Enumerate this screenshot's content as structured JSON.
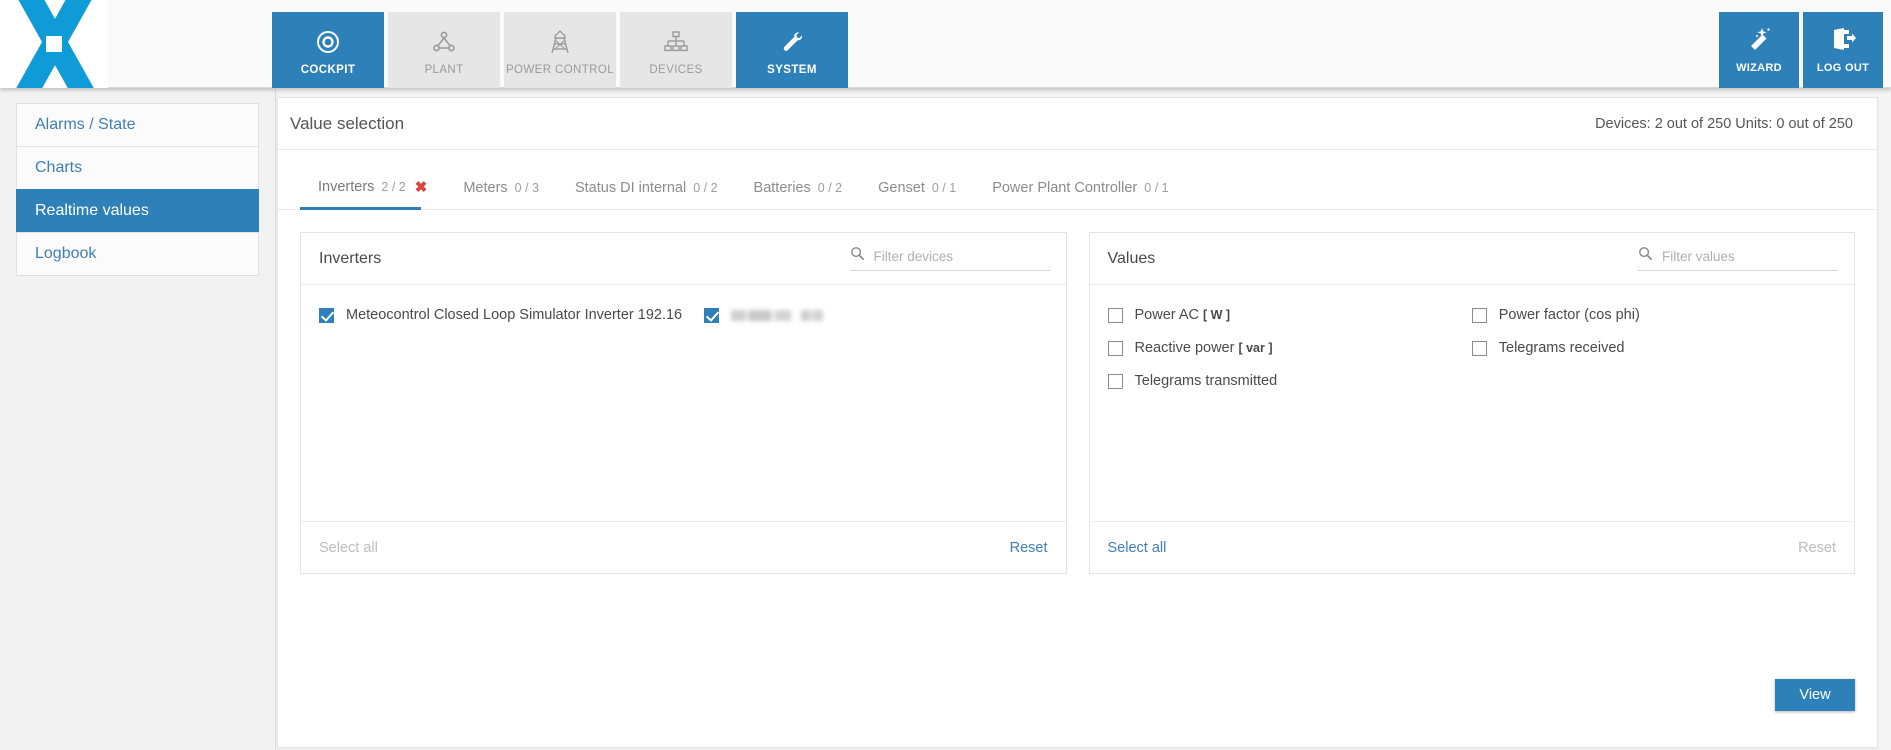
{
  "header": {
    "nav_tabs": [
      {
        "label": "COCKPIT",
        "icon": "cockpit-icon",
        "active": true
      },
      {
        "label": "PLANT",
        "icon": "plant-icon",
        "active": false
      },
      {
        "label": "POWER CONTROL",
        "icon": "power-control-icon",
        "active": false
      },
      {
        "label": "DEVICES",
        "icon": "devices-icon",
        "active": false
      },
      {
        "label": "SYSTEM",
        "icon": "wrench-icon",
        "active": true
      }
    ],
    "actions": [
      {
        "label": "WIZARD",
        "icon": "magic-wand-icon"
      },
      {
        "label": "LOG OUT",
        "icon": "logout-icon"
      }
    ]
  },
  "sidebar": {
    "items": [
      {
        "label": "Alarms / State",
        "active": false
      },
      {
        "label": "Charts",
        "active": false
      },
      {
        "label": "Realtime values",
        "active": true
      },
      {
        "label": "Logbook",
        "active": false
      }
    ]
  },
  "main": {
    "title": "Value selection",
    "device_counter": "Devices: 2 out of 250 Units: 0 out of 250",
    "tabs": [
      {
        "label": "Inverters",
        "count": "2 / 2",
        "active": true,
        "has_clear": true
      },
      {
        "label": "Meters",
        "count": "0 / 3",
        "active": false,
        "has_clear": false
      },
      {
        "label": "Status DI internal",
        "count": "0 / 2",
        "active": false,
        "has_clear": false
      },
      {
        "label": "Batteries",
        "count": "0 / 2",
        "active": false,
        "has_clear": false
      },
      {
        "label": "Genset",
        "count": "0 / 1",
        "active": false,
        "has_clear": false
      },
      {
        "label": "Power Plant Controller",
        "count": "0 / 1",
        "active": false,
        "has_clear": false
      }
    ],
    "devices_panel": {
      "title": "Inverters",
      "filter_placeholder": "Filter devices",
      "filter_value": "",
      "items": [
        {
          "label": "Meteocontrol Closed Loop Simulator Inverter 192.16",
          "checked": true,
          "redacted": false
        },
        {
          "label": "",
          "checked": true,
          "redacted": true
        }
      ],
      "select_all_label": "Select all",
      "select_all_enabled": false,
      "reset_label": "Reset",
      "reset_enabled": true
    },
    "values_panel": {
      "title": "Values",
      "filter_placeholder": "Filter values",
      "filter_value": "",
      "column_left": [
        {
          "label": "Power AC",
          "unit": "[ W ]",
          "checked": false
        },
        {
          "label": "Reactive power",
          "unit": "[ var ]",
          "checked": false
        },
        {
          "label": "Telegrams transmitted",
          "unit": "",
          "checked": false
        }
      ],
      "column_right": [
        {
          "label": "Power factor (cos phi)",
          "unit": "",
          "checked": false
        },
        {
          "label": "Telegrams received",
          "unit": "",
          "checked": false
        }
      ],
      "select_all_label": "Select all",
      "select_all_enabled": true,
      "reset_label": "Reset",
      "reset_enabled": false
    },
    "view_button": "View"
  },
  "colors": {
    "accent": "#2e80b8",
    "logo_blue": "#0f9bd7",
    "link": "#3f7fb5",
    "clear_red": "#d9453c",
    "disabled": "#bdbdbd"
  }
}
